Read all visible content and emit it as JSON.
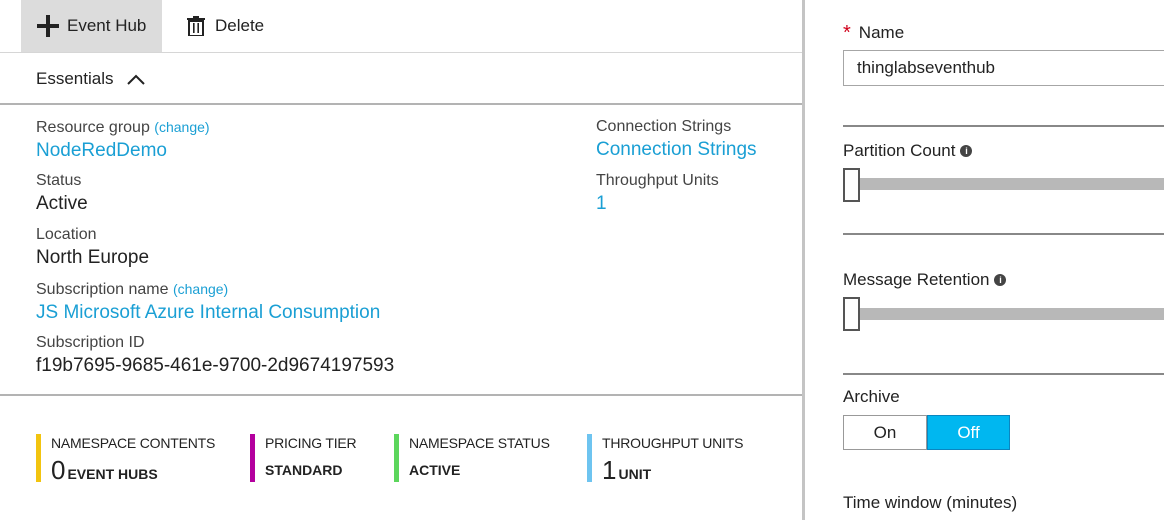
{
  "toolbar": {
    "add_label": "Event Hub",
    "delete_label": "Delete"
  },
  "essentials": {
    "label": "Essentials"
  },
  "properties": {
    "resource_group": {
      "label": "Resource group",
      "change": "(change)",
      "value": "NodeRedDemo"
    },
    "status": {
      "label": "Status",
      "value": "Active"
    },
    "location": {
      "label": "Location",
      "value": "North Europe"
    },
    "subscription_name": {
      "label": "Subscription name",
      "change": "(change)",
      "value": "JS Microsoft Azure Internal Consumption"
    },
    "subscription_id": {
      "label": "Subscription ID",
      "value": "f19b7695-9685-461e-9700-2d9674197593"
    },
    "connection_strings": {
      "label": "Connection Strings",
      "value": "Connection Strings"
    },
    "throughput_units": {
      "label": "Throughput Units",
      "value": "1"
    }
  },
  "tiles": [
    {
      "title": "NAMESPACE CONTENTS",
      "number": "0",
      "unit": "EVENT HUBS",
      "color": "#f2c40f"
    },
    {
      "title": "PRICING TIER",
      "word": "STANDARD",
      "color": "#b4009e"
    },
    {
      "title": "NAMESPACE STATUS",
      "word": "ACTIVE",
      "color": "#5cd65c"
    },
    {
      "title": "THROUGHPUT UNITS",
      "number": "1",
      "unit": "UNIT",
      "color": "#6ec4f0"
    }
  ],
  "form": {
    "name_label": "Name",
    "name_value": "thinglabseventhub",
    "partition_count_label": "Partition Count",
    "partition_count_level": 0,
    "message_retention_label": "Message Retention",
    "message_retention_level": 0,
    "archive_label": "Archive",
    "archive_on": "On",
    "archive_off": "Off",
    "archive_selected": "Off",
    "time_window_label": "Time window (minutes)"
  },
  "colors": {
    "link": "#1a9fd4",
    "toggle_active": "#00b7f0",
    "required": "#d0021b"
  }
}
